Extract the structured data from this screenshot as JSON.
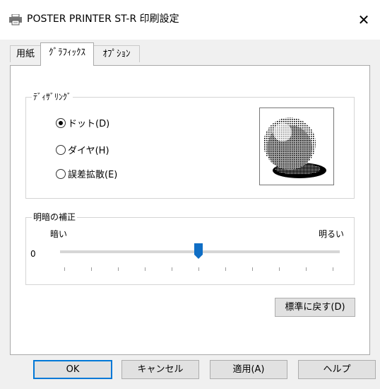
{
  "window": {
    "title": "POSTER PRINTER ST-R 印刷設定",
    "icon": "printer-icon",
    "close_glyph": "✕"
  },
  "tabs": [
    {
      "label": "用紙",
      "active": false
    },
    {
      "label": "ｸﾞﾗﾌｨｯｸｽ",
      "active": true
    },
    {
      "label": "ｵﾌﾟｼｮﾝ",
      "active": false
    }
  ],
  "dithering": {
    "title": "ﾃﾞｨｻﾞﾘﾝｸﾞ",
    "options": [
      {
        "label": "ドット(D)",
        "checked": true
      },
      {
        "label": "ダイヤ(H)",
        "checked": false
      },
      {
        "label": "誤差拡散(E)",
        "checked": false
      }
    ]
  },
  "brightness": {
    "title": "明暗の補正",
    "dark_label": "暗い",
    "bright_label": "明るい",
    "value_label": "0",
    "position": 0.5
  },
  "buttons": {
    "reset": "標準に戻す(D)",
    "ok": "OK",
    "cancel": "キャンセル",
    "apply": "適用(A)",
    "help": "ヘルプ"
  },
  "colors": {
    "accent": "#0078d7",
    "thumb": "#0f6ec5"
  }
}
